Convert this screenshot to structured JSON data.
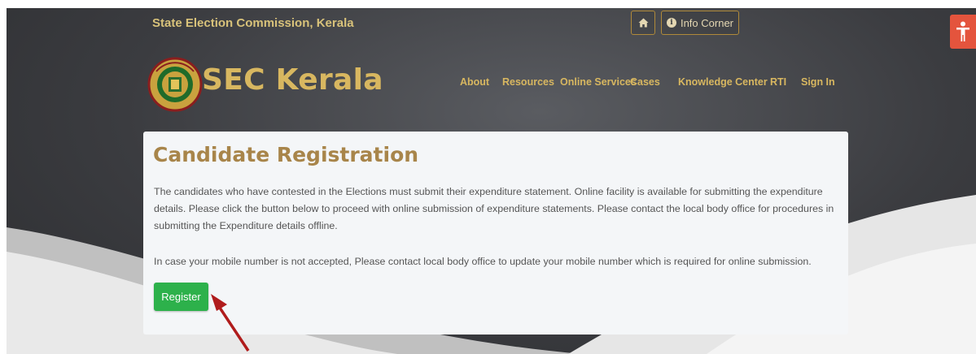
{
  "header": {
    "site_title": "State Election Commission, Kerala",
    "home_icon": "home-icon",
    "info_label": "Info Corner",
    "info_icon": "info-circle-icon",
    "accessibility_icon": "accessibility-person-icon"
  },
  "logo": {
    "emblem_text": "STATE ELECTION COMMISSION KERALA",
    "text": "SEC Kerala"
  },
  "nav": {
    "items": [
      "About",
      "Resources",
      "Online Services",
      "Cases",
      "Knowledge Center",
      "RTI",
      "Sign In"
    ]
  },
  "main": {
    "title": "Candidate Registration",
    "paragraph1": "The candidates who have contested in the Elections must submit their expenditure statement. Online facility is available for submitting the expenditure details. Please click the button below to proceed with online submission of expenditure statements. Please contact the local body office for procedures in submitting the Expenditure details offline.",
    "paragraph2": "In case your mobile number is not accepted, Please contact local body office to update your mobile number which is required for online submission.",
    "register_label": "Register"
  },
  "colors": {
    "brand_gold": "#d8b760",
    "title_brown": "#a8854a",
    "button_green": "#2db14b",
    "accessibility_red": "#e4543d",
    "arrow_red": "#b01c1c"
  }
}
